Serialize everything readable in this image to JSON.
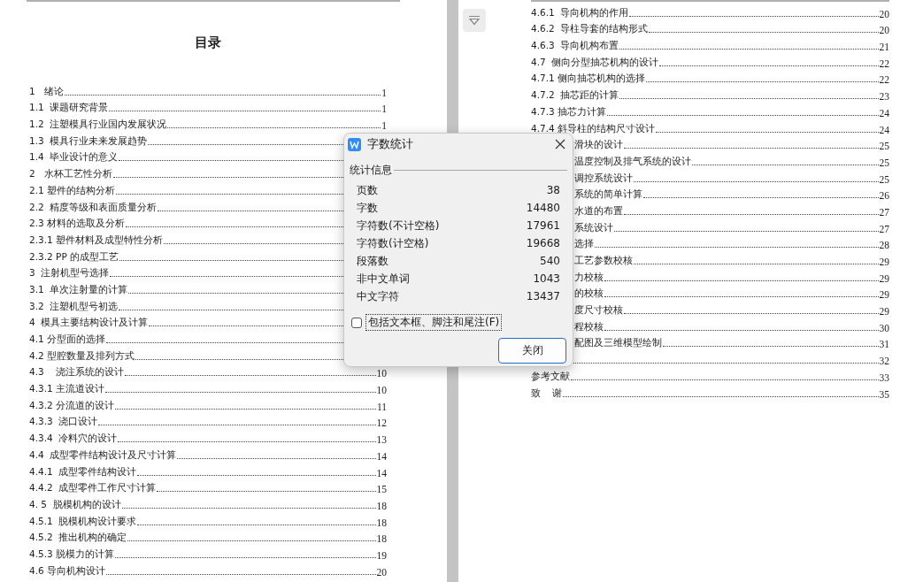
{
  "left_page": {
    "title": "目录",
    "entries": [
      {
        "title": "1   绪论",
        "page": "1"
      },
      {
        "title": "1.1  课题研究背景",
        "page": "1"
      },
      {
        "title": "1.2  注塑模具行业国内发展状况",
        "page": "1"
      },
      {
        "title": "1.3  模具行业未来发展趋势"
      },
      {
        "title": "1.4  毕业设计的意义"
      },
      {
        "title": "2   水杯工艺性分析"
      },
      {
        "title": "2.1 塑件的结构分析"
      },
      {
        "title": "2.2  精度等级和表面质量分析"
      },
      {
        "title": "2.3 材料的选取及分析"
      },
      {
        "title": "2.3.1 塑件材料及成型特性分析"
      },
      {
        "title": "2.3.2 PP 的成型工艺"
      },
      {
        "title": "3  注射机型号选择"
      },
      {
        "title": "3.1  单次注射量的计算"
      },
      {
        "title": "3.2  注塑机型号初选"
      },
      {
        "title": "4  模具主要结构设计及计算"
      },
      {
        "title": "4.1 分型面的选择"
      },
      {
        "title": "4.2 型腔数量及排列方式"
      },
      {
        "title": "4.3    浇注系统的设计",
        "page": "10"
      },
      {
        "title": "4.3.1 主流道设计",
        "page": "10"
      },
      {
        "title": "4.3.2 分流道的设计",
        "page": "11"
      },
      {
        "title": "4.3.3  浇口设计",
        "page": "12"
      },
      {
        "title": "4.3.4  冷料穴的设计",
        "page": "13"
      },
      {
        "title": "4.4  成型零件结构设计及尺寸计算",
        "page": "14"
      },
      {
        "title": "4.4.1  成型零件结构设计",
        "page": "14"
      },
      {
        "title": "4.4.2  成型零件工作尺寸计算",
        "page": "15"
      },
      {
        "title": "4. 5  脱模机构的设计",
        "page": "18"
      },
      {
        "title": "4.5.1  脱模机构设计要求",
        "page": "18"
      },
      {
        "title": "4.5.2  推出机构的确定",
        "page": "18"
      },
      {
        "title": "4.5.3 脱模力的计算",
        "page": "19"
      },
      {
        "title": "4.6 导向机构设计",
        "page": "20"
      }
    ]
  },
  "right_page": {
    "entries": [
      {
        "title": "4.6.1  导向机构的作用",
        "page": "20",
        "clipped": false
      },
      {
        "title": "4.6.2  导柱导套的结构形式",
        "page": "20",
        "clipped": false
      },
      {
        "title": "4.6.3  导向机构布置",
        "page": "21",
        "clipped": false
      },
      {
        "title": "4.7  侧向分型抽芯机构的设计",
        "page": "22",
        "clipped": false
      },
      {
        "title": "4.7.1 侧向抽芯机构的选择",
        "page": "22",
        "clipped": false
      },
      {
        "title": "4.7.2  抽芯距的计算",
        "page": "23",
        "clipped": false
      },
      {
        "title": "4.7.3 抽芯力计算",
        "page": "24",
        "clipped": false
      },
      {
        "title": "4.7.4 斜导柱的结构尺寸设计",
        "page": "24",
        "clipped": false
      },
      {
        "title": "滑块的设计",
        "page": "25",
        "clipped": true
      },
      {
        "title": "温度控制及排气系统的设计",
        "page": "25",
        "clipped": true
      },
      {
        "title": "调控系统设计",
        "page": "25",
        "clipped": true
      },
      {
        "title": "系统的简单计算",
        "page": "26",
        "clipped": true
      },
      {
        "title": "水道的布置",
        "page": "27",
        "clipped": true
      },
      {
        "title": "系统设计",
        "page": "27",
        "clipped": true
      },
      {
        "title": "选择",
        "page": "28",
        "clipped": true
      },
      {
        "title": "工艺参数校核",
        "page": "29",
        "clipped": true
      },
      {
        "title": "力校核",
        "page": "29",
        "clipped": true
      },
      {
        "title": "的校核",
        "page": "29",
        "clipped": true
      },
      {
        "title": "度尺寸校核",
        "page": "29",
        "clipped": true
      },
      {
        "title": "程校核",
        "page": "30",
        "clipped": true
      },
      {
        "title": "配图及三维模型绘制",
        "page": "31",
        "clipped": true
      },
      {
        "page": "32"
      },
      {
        "title": "参考文献",
        "page": "33",
        "clipped": false
      },
      {
        "title": "致    谢",
        "page": "35",
        "clipped": false
      }
    ]
  },
  "dialog": {
    "title": "字数统计",
    "section": "统计信息",
    "stats": [
      {
        "label": "页数",
        "value": "38"
      },
      {
        "label": "字数",
        "value": "14480"
      },
      {
        "label": "字符数(不计空格)",
        "value": "17961"
      },
      {
        "label": "字符数(计空格)",
        "value": "19668"
      },
      {
        "label": "段落数",
        "value": "540"
      },
      {
        "label": "非中文单词",
        "value": "1043"
      },
      {
        "label": "中文字符",
        "value": "13437"
      }
    ],
    "checkbox": {
      "label": "包括文本框、脚注和尾注(F)",
      "checked": false
    },
    "close_button": "关闭"
  }
}
